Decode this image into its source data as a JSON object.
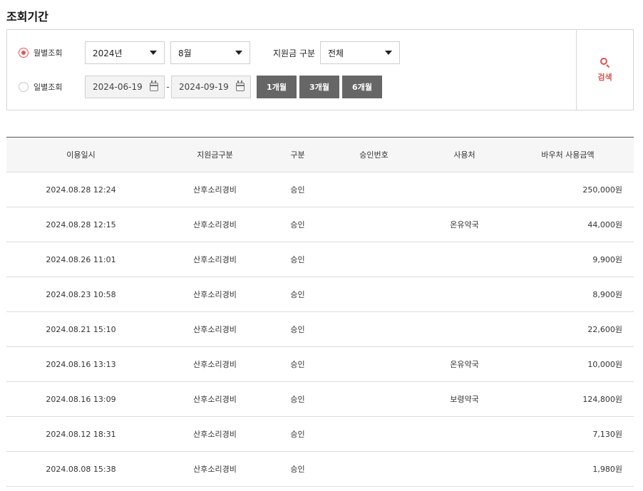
{
  "section_title": "조회기간",
  "search": {
    "radio_monthly": "월별조회",
    "radio_daily": "일별조회",
    "year": "2024년",
    "month": "8월",
    "fund_label": "지원금 구분",
    "fund_value": "전체",
    "date_from": "2024-06-19",
    "date_to": "2024-09-19",
    "date_sep": "-",
    "btn_1m": "1개월",
    "btn_3m": "3개월",
    "btn_6m": "6개월",
    "search_btn": "검색"
  },
  "table": {
    "headers": [
      "이용일시",
      "지원금구분",
      "구분",
      "승인번호",
      "사용처",
      "바우처 사용금액"
    ],
    "rows": [
      {
        "date": "2024.08.28 12:24",
        "fund": "산후소리경비",
        "type": "승인",
        "approval": "",
        "place": "",
        "amount": "250,000원"
      },
      {
        "date": "2024.08.28 12:15",
        "fund": "산후소리경비",
        "type": "승인",
        "approval": "",
        "place": "온유약국",
        "amount": "44,000원"
      },
      {
        "date": "2024.08.26 11:01",
        "fund": "산후소리경비",
        "type": "승인",
        "approval": "",
        "place": "",
        "amount": "9,900원"
      },
      {
        "date": "2024.08.23 10:58",
        "fund": "산후소리경비",
        "type": "승인",
        "approval": "",
        "place": "",
        "amount": "8,900원"
      },
      {
        "date": "2024.08.21 15:10",
        "fund": "산후소리경비",
        "type": "승인",
        "approval": "",
        "place": "",
        "amount": "22,600원"
      },
      {
        "date": "2024.08.16 13:13",
        "fund": "산후소리경비",
        "type": "승인",
        "approval": "",
        "place": "온유약국",
        "amount": "10,000원"
      },
      {
        "date": "2024.08.16 13:09",
        "fund": "산후소리경비",
        "type": "승인",
        "approval": "",
        "place": "보령약국",
        "amount": "124,800원"
      },
      {
        "date": "2024.08.12 18:31",
        "fund": "산후소리경비",
        "type": "승인",
        "approval": "",
        "place": "",
        "amount": "7,130원"
      },
      {
        "date": "2024.08.08 15:38",
        "fund": "산후소리경비",
        "type": "승인",
        "approval": "",
        "place": "",
        "amount": "1,980원"
      }
    ]
  },
  "colors": {
    "accent": "#e05858",
    "button_gray": "#666666",
    "header_bg": "#f6f6f6"
  }
}
